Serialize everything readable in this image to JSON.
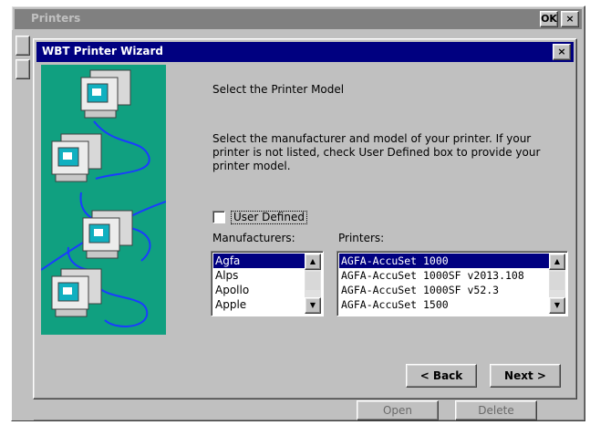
{
  "background_window": {
    "title": "Printers",
    "ok_label": "OK",
    "close_label": "×",
    "hidden_button_1": "Open",
    "hidden_button_2": "Delete"
  },
  "wizard": {
    "title": "WBT Printer Wizard",
    "close_label": "×",
    "heading": "Select the Printer Model",
    "instructions": "Select the manufacturer and model of your printer. If your printer is not listed, check User Defined box to provide your printer model.",
    "user_defined": {
      "label": "User Defined",
      "checked": false
    },
    "manufacturers": {
      "label": "Manufacturers:",
      "items": [
        "Agfa",
        "Alps",
        "Apollo",
        "Apple"
      ],
      "selected_index": 0
    },
    "printers": {
      "label": "Printers:",
      "items": [
        "AGFA-AccuSet 1000",
        "AGFA-AccuSet 1000SF v2013.108",
        "AGFA-AccuSet 1000SF v52.3",
        "AGFA-AccuSet 1500"
      ],
      "selected_index": 0
    },
    "back_label": "< Back",
    "next_label": "Next >"
  },
  "colors": {
    "title_active": "#000080",
    "title_inactive": "#808080",
    "illustration_bg": "#10a080",
    "network_lines": "#1a3cff",
    "face": "#c0c0c0"
  }
}
